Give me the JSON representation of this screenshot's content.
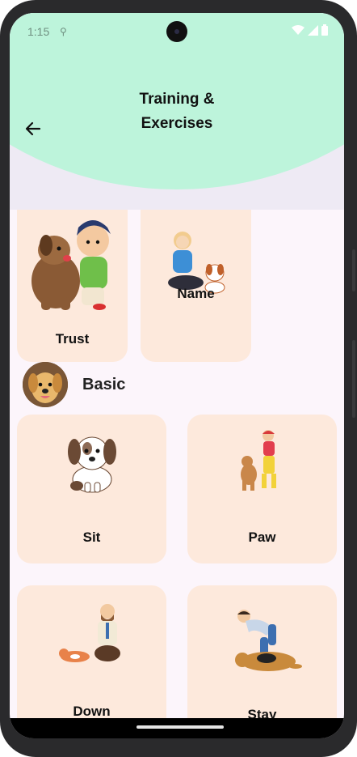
{
  "status_bar": {
    "time": "1:15",
    "wifi_icon": "wifi-icon",
    "signal_icon": "signal-icon",
    "battery_icon": "battery-icon"
  },
  "header": {
    "title": "Training & Exercises",
    "back_icon": "arrow-left-icon",
    "accent_color": "#bdf4db"
  },
  "top_cards": [
    {
      "label": "Trust",
      "illustration": "boy-hugging-dog"
    },
    {
      "label": "Name",
      "illustration": "girl-with-puppy"
    }
  ],
  "section": {
    "title": "Basic",
    "avatar": "dog-avatar"
  },
  "basic_cards": [
    {
      "label": "Sit",
      "illustration": "sitting-puppy"
    },
    {
      "label": "Paw",
      "illustration": "kid-playing-with-dog"
    },
    {
      "label": "Down",
      "illustration": "man-with-lying-dog"
    },
    {
      "label": "Stay",
      "illustration": "man-petting-dog"
    }
  ],
  "colors": {
    "card_bg": "#fde9dc",
    "page_bg": "#fcf5fb"
  }
}
